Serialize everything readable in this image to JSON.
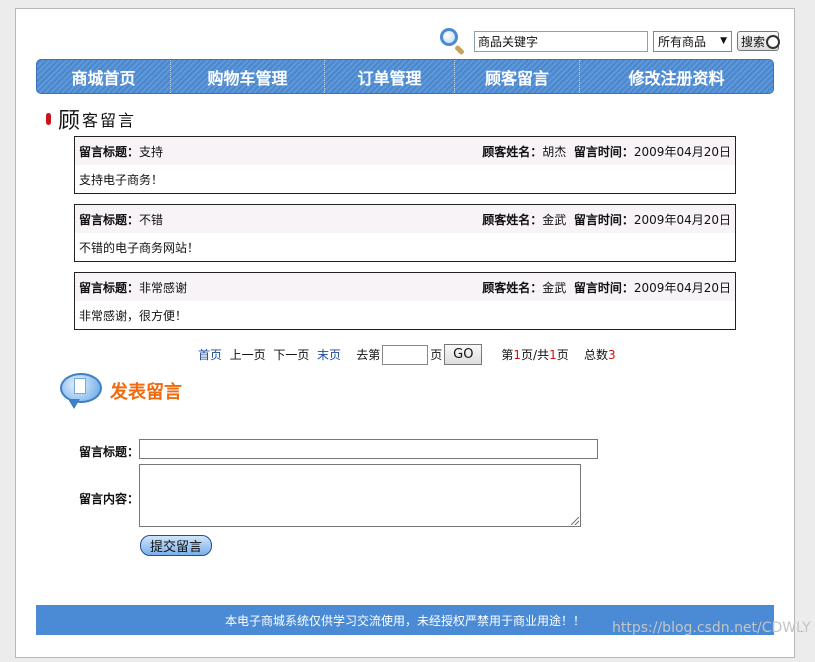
{
  "search": {
    "value": "商品关键字",
    "category": "所有商品",
    "button": "搜索"
  },
  "nav": [
    "商城首页",
    "购物车管理",
    "订单管理",
    "顾客留言",
    "修改注册资料"
  ],
  "section": {
    "big": "顾",
    "rest": "客留言"
  },
  "messages": [
    {
      "title_label": "留言标题：",
      "title": "支持",
      "name_label": "顾客姓名：",
      "name": "胡杰",
      "time_label": "留言时间：",
      "time": "2009年04月20日",
      "content": "支持电子商务！"
    },
    {
      "title_label": "留言标题：",
      "title": "不错",
      "name_label": "顾客姓名：",
      "name": "金武",
      "time_label": "留言时间：",
      "time": "2009年04月20日",
      "content": "不错的电子商务网站！"
    },
    {
      "title_label": "留言标题：",
      "title": "非常感谢",
      "name_label": "顾客姓名：",
      "name": "金武",
      "time_label": "留言时间：",
      "time": "2009年04月20日",
      "content": "非常感谢，很方便！"
    }
  ],
  "pager": {
    "first": "首页",
    "prev": "上一页",
    "next": "下一页",
    "last": "末页",
    "goto_pre": "去第",
    "goto_post": "页",
    "go": "GO",
    "info_1": "第",
    "current": "1",
    "info_2": "页/共",
    "total_pages": "1",
    "info_3": "页",
    "count_label": "总数",
    "count": "3"
  },
  "post": {
    "heading": "发表留言",
    "title_label": "留言标题：",
    "content_label": "留言内容：",
    "submit": "提交留言"
  },
  "footer": "本电子商城系统仅供学习交流使用，未经授权严禁用于商业用途！！",
  "watermark": "https://blog.csdn.net/CDWLY",
  "colors": {
    "nav": "#4c87cc",
    "footer": "#4b8bd6",
    "accent": "#f06a10",
    "count": "#d01010"
  }
}
